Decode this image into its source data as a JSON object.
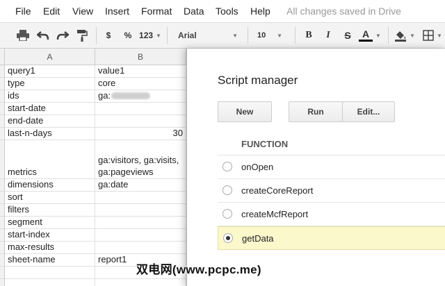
{
  "menu": {
    "items": [
      "File",
      "Edit",
      "View",
      "Insert",
      "Format",
      "Data",
      "Tools",
      "Help"
    ],
    "status": "All changes saved in Drive"
  },
  "toolbar": {
    "currency": "$",
    "percent": "%",
    "number_format": "123",
    "font": "Arial",
    "size": "10",
    "bold": "B",
    "italic": "I",
    "strike": "S",
    "text_color": "A"
  },
  "grid": {
    "columns": [
      "A",
      "B"
    ],
    "rows": [
      {
        "a": "query1",
        "b": "value1"
      },
      {
        "a": "type",
        "b": "core"
      },
      {
        "a": "ids",
        "b": "ga:"
      },
      {
        "a": "start-date",
        "b": ""
      },
      {
        "a": "end-date",
        "b": ""
      },
      {
        "a": "last-n-days",
        "b": "30"
      },
      {
        "a": "metrics",
        "b": "ga:visitors, ga:visits, ga:pageviews"
      },
      {
        "a": "dimensions",
        "b": "ga:date"
      },
      {
        "a": "sort",
        "b": ""
      },
      {
        "a": "filters",
        "b": ""
      },
      {
        "a": "segment",
        "b": ""
      },
      {
        "a": "start-index",
        "b": ""
      },
      {
        "a": "max-results",
        "b": ""
      },
      {
        "a": "sheet-name",
        "b": "report1"
      }
    ]
  },
  "dialog": {
    "title": "Script manager",
    "buttons": {
      "new": "New",
      "run": "Run",
      "edit": "Edit..."
    },
    "function_header": "FUNCTION",
    "functions": [
      "onOpen",
      "createCoreReport",
      "createMcfReport",
      "getData"
    ],
    "selected_function": "getData"
  },
  "watermark": "双电网(www.pcpc.me)"
}
